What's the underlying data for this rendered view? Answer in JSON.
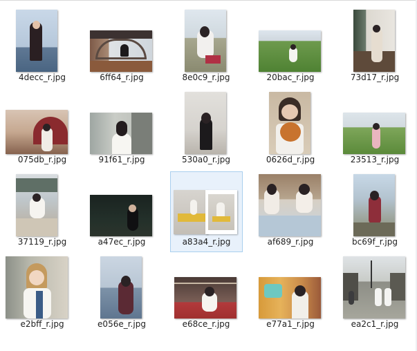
{
  "window": {
    "title": ""
  },
  "files": [
    {
      "name": "4decc_r.jpg",
      "subject": "woman by the sea, portrait"
    },
    {
      "name": "6ff64_r.jpg",
      "subject": "woman framed in a window, landscape"
    },
    {
      "name": "8e0c9_r.jpg",
      "subject": "woman sitting outdoors, portrait"
    },
    {
      "name": "20bac_r.jpg",
      "subject": "woman on a lawn, landscape"
    },
    {
      "name": "73d17_r.jpg",
      "subject": "woman on a balcony, portrait"
    },
    {
      "name": "075db_r.jpg",
      "subject": "woman with umbrella, landscape"
    },
    {
      "name": "91f61_r.jpg",
      "subject": "woman in white t-shirt, landscape"
    },
    {
      "name": "530a0_r.jpg",
      "subject": "woman in black dress, portrait"
    },
    {
      "name": "0626d_r.jpg",
      "subject": "woman holding a basketball, portrait"
    },
    {
      "name": "23513_r.jpg",
      "subject": "woman in a green field, landscape"
    },
    {
      "name": "37119_r.jpg",
      "subject": "woman sitting on steps, portrait"
    },
    {
      "name": "a47ec_r.jpg",
      "subject": "woman at night, landscape"
    },
    {
      "name": "a83a4_r.jpg",
      "subject": "folder with photo previews, selected"
    },
    {
      "name": "af689_r.jpg",
      "subject": "two women reading at a table, landscape"
    },
    {
      "name": "bc69f_r.jpg",
      "subject": "woman in a park, portrait"
    },
    {
      "name": "e2bff_r.jpg",
      "subject": "woman by a train window, portrait"
    },
    {
      "name": "e056e_r.jpg",
      "subject": "woman by the water, portrait"
    },
    {
      "name": "e68ce_r.jpg",
      "subject": "woman with red railings, landscape"
    },
    {
      "name": "e77a1_r.jpg",
      "subject": "woman with lanterns, landscape"
    },
    {
      "name": "ea2c1_r.jpg",
      "subject": "two women in an alley, landscape"
    }
  ],
  "selection": {
    "selected_file": "a83a4_r.jpg"
  },
  "colors": {
    "selection_fill": "#e8f1fb",
    "selection_border": "#a9cfee",
    "label_text": "#1e1e1e"
  }
}
